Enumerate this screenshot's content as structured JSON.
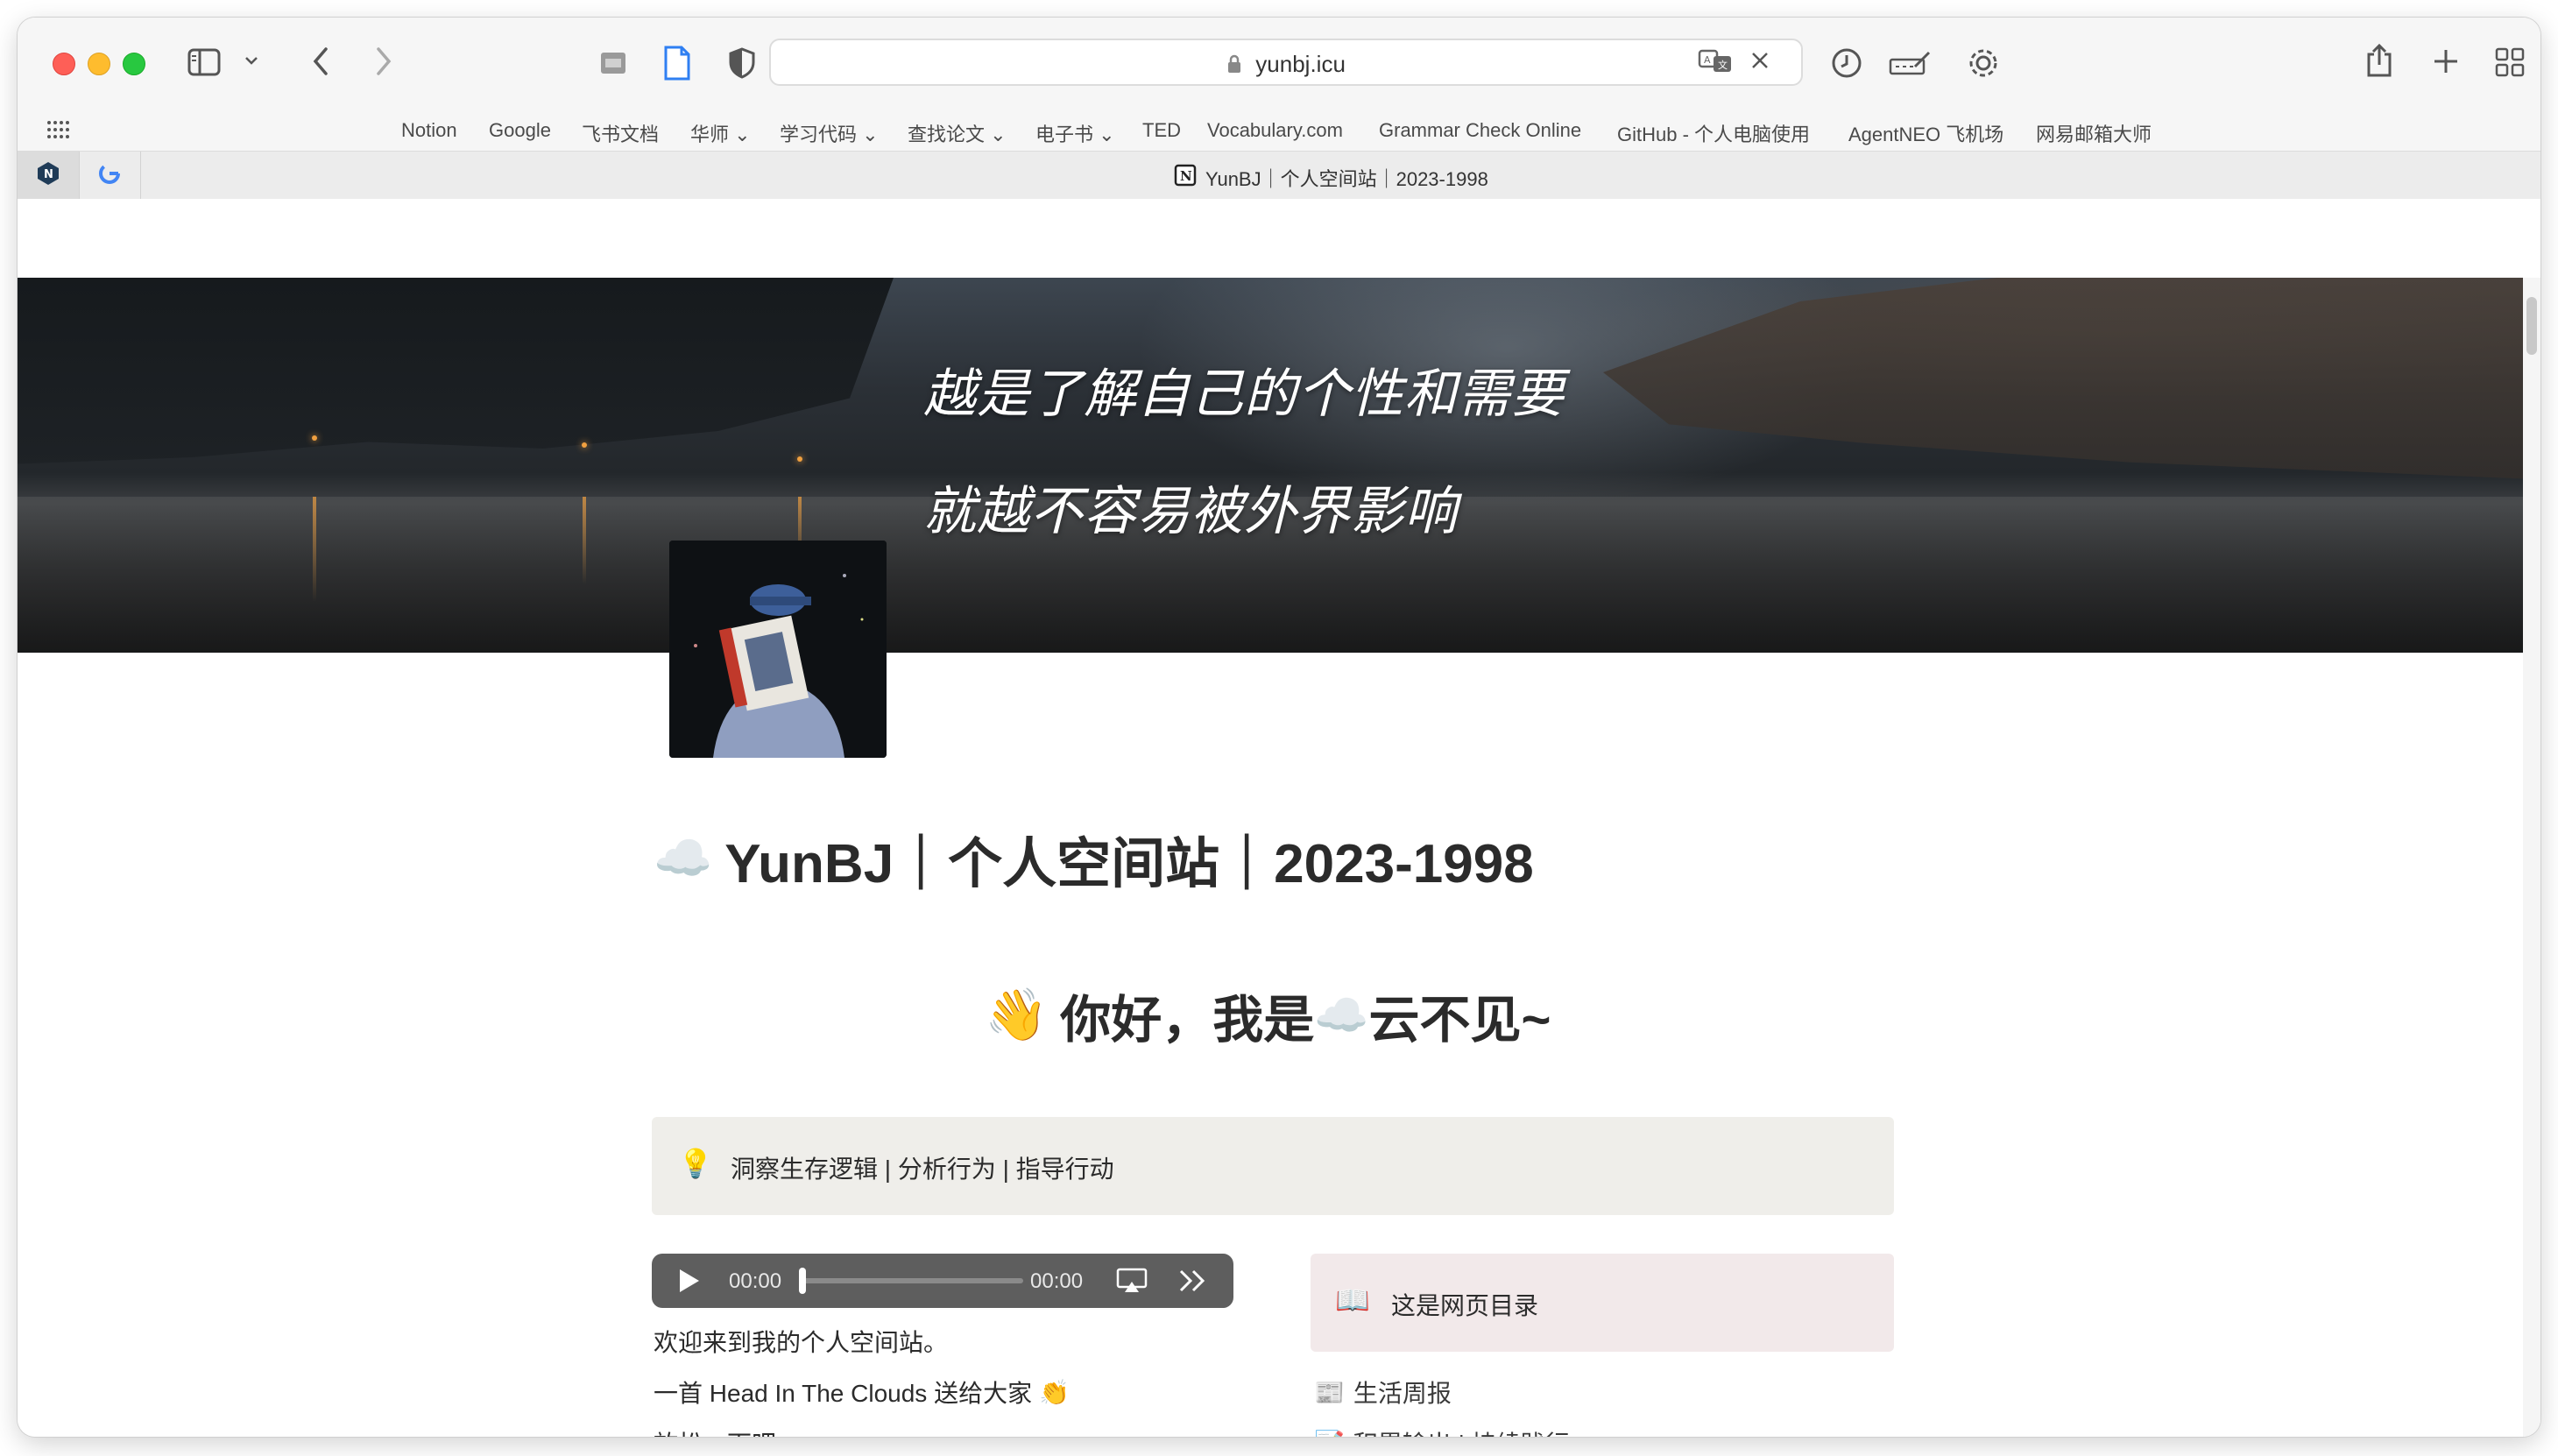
{
  "browser": {
    "url": "yunbj.icu",
    "bookmarks": [
      {
        "label": "Notion"
      },
      {
        "label": "Google"
      },
      {
        "label": "飞书文档"
      },
      {
        "label": "华师 ⌄"
      },
      {
        "label": "学习代码 ⌄"
      },
      {
        "label": "查找论文 ⌄"
      },
      {
        "label": "电子书 ⌄"
      },
      {
        "label": "TED"
      },
      {
        "label": "Vocabulary.com"
      },
      {
        "label": "Grammar Check Online"
      },
      {
        "label": "GitHub - 个人电脑使用"
      },
      {
        "label": "AgentNEO 飞机场"
      },
      {
        "label": "网易邮箱大师"
      }
    ],
    "tab_title": "YunBJ｜个人空间站｜2023-1998"
  },
  "banner": {
    "line1": "越是了解自己的个性和需要",
    "line2": "就越不容易被外界影响"
  },
  "page": {
    "title_emoji": "☁️",
    "title": "YunBJ｜个人空间站｜2023-1998",
    "greeting_emoji": "👋",
    "greeting_part1": "你好，我是",
    "greeting_cloud": "☁️",
    "greeting_part2": "云不见~",
    "callout_icon": "💡",
    "callout_text": "洞察生存逻辑 | 分析行为 | 指导行动",
    "audio": {
      "current": "00:00",
      "duration": "00:00"
    },
    "intro_lines": [
      "欢迎来到我的个人空间站。",
      "一首 Head In The Clouds 送给大家",
      "放松一下吧~"
    ],
    "intro_emoji": "👏",
    "toc_icon": "📖",
    "toc_title": "这是网页目录",
    "toc_items": [
      {
        "icon": "📰",
        "label": "生活周报"
      },
      {
        "icon": "📝",
        "label": "积累输出 | 持续践行"
      }
    ]
  }
}
